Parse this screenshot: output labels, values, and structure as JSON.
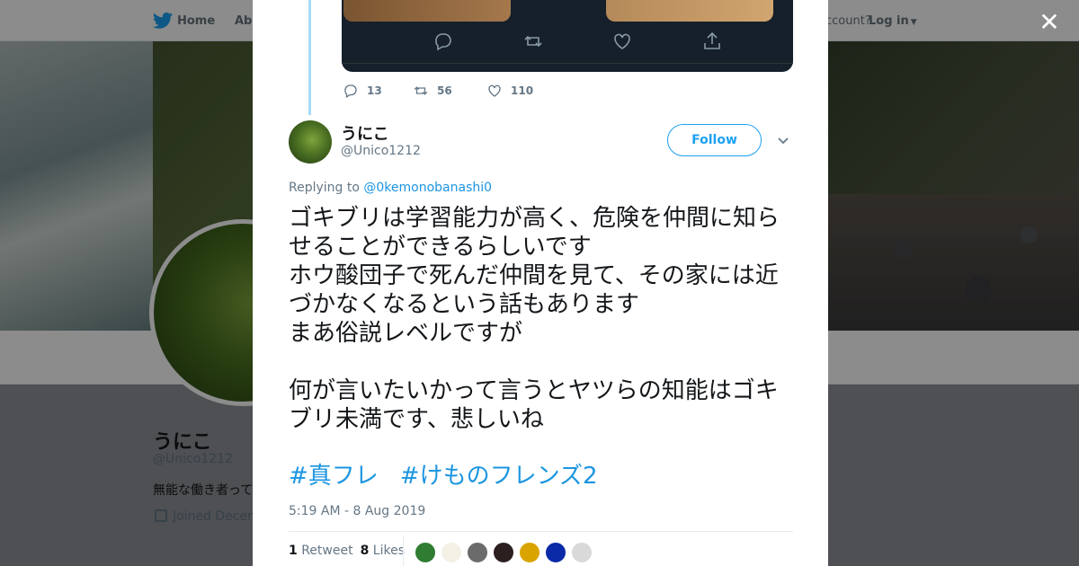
{
  "nav": {
    "home_label": "Home",
    "about_label": "Abo",
    "account_prompt": "ccount?",
    "login_label": "Log in"
  },
  "profile": {
    "name": "うにこ",
    "handle": "@Unico1212",
    "bio": "無能な働き者って",
    "joined": "Joined Decem"
  },
  "previous_tweet": {
    "reply_count": "13",
    "retweet_count": "56",
    "like_count": "110"
  },
  "tweet": {
    "author_name": "うにこ",
    "author_handle": "@Unico1212",
    "follow_label": "Follow",
    "replying_prefix": "Replying to",
    "replying_handle": "@0kemonobanashi0",
    "text": "ゴキブリは学習能力が高く、危険を仲間に知らせることができるらしいです\nホウ酸団子で死んだ仲間を見て、その家には近づかなくなるという話もあります\nまあ俗説レベルですが\n\n何が言いたいかって言うとヤツらの知能はゴキブリ未満です、悲しいね",
    "hashtags": [
      "#真フレ",
      "#けものフレンズ2"
    ],
    "timestamp": "5:19 AM - 8 Aug 2019",
    "retweet_count": "1",
    "retweet_label": "Retweet",
    "like_count": "8",
    "like_label": "Likes"
  },
  "likers": [
    {
      "icon": "green-character-avatar",
      "color": "#2e7d32"
    },
    {
      "icon": "white-character-avatar",
      "color": "#f3f1e6"
    },
    {
      "icon": "grey-anime-avatar",
      "color": "#6b6b6b"
    },
    {
      "icon": "dark-anime-avatar",
      "color": "#2b1f1f"
    },
    {
      "icon": "yellow-red-avatar",
      "color": "#d9a400"
    },
    {
      "icon": "blue-black-avatar",
      "color": "#0a2aa8"
    },
    {
      "icon": "cup-avatar",
      "color": "#d9d9d9"
    }
  ],
  "colors": {
    "accent": "#1da1f2",
    "link": "#1b95e0",
    "text": "#14171a",
    "muted": "#657786"
  }
}
